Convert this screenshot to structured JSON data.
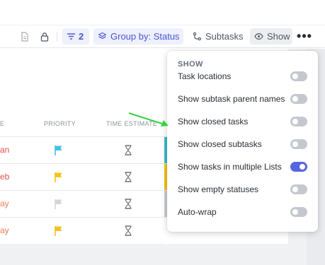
{
  "toolbar": {
    "filter_count": "2",
    "group_by_label": "Group by: Status",
    "subtasks_label": "Subtasks",
    "show_label": "Show",
    "more_label": "•••"
  },
  "table": {
    "headers": {
      "e": "E",
      "priority": "PRIORITY",
      "time_estimate": "TIME ESTIMATE"
    },
    "rows": [
      {
        "due": "an",
        "due_color": "#e04e4e",
        "flag_color": "#3ec1e8",
        "stripe_color": "#3fb8c8"
      },
      {
        "due": "eb",
        "due_color": "#e04e4e",
        "flag_color": "#f4c21b",
        "stripe_color": "#f0c21b"
      },
      {
        "due": "ay",
        "due_color": "#f07b4a",
        "flag_color": "#d2d5da",
        "stripe_color": "#c9ccd1"
      },
      {
        "due": "ay",
        "due_color": "#f07b4a",
        "flag_color": "#f4c21b",
        "stripe_color": "#ffffff"
      }
    ]
  },
  "menu": {
    "title": "SHOW",
    "items": [
      {
        "label": "Task locations",
        "on": false
      },
      {
        "label": "Show subtask parent names",
        "on": false
      },
      {
        "label": "Show closed tasks",
        "on": false
      },
      {
        "label": "Show closed subtasks",
        "on": false
      },
      {
        "label": "Show tasks in multiple Lists",
        "on": true
      },
      {
        "label": "Show empty statuses",
        "on": false
      },
      {
        "label": "Auto-wrap",
        "on": false
      }
    ]
  },
  "colors": {
    "accent": "#5565e0",
    "annotation_arrow": "#3ad13a"
  }
}
